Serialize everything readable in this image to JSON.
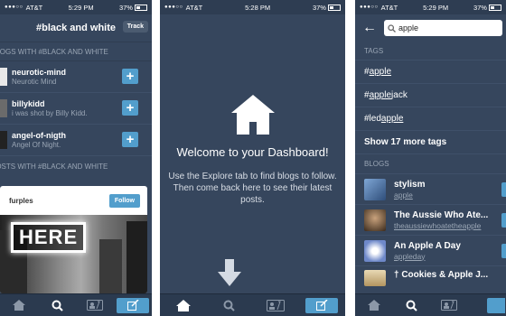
{
  "status": {
    "carrier": "AT&T",
    "time1": "5:29 PM",
    "time2": "5:28 PM",
    "time3": "5:29 PM",
    "battery": "37%"
  },
  "panel1": {
    "title": "#black and white",
    "track_label": "Track",
    "section_blogs": "BLOGS WITH #BLACK AND WHITE",
    "blogs": [
      {
        "name": "neurotic-mind",
        "subtitle": "Neurotic Mind"
      },
      {
        "name": "billykidd",
        "subtitle": "i was shot by Billy Kidd."
      },
      {
        "name": "angel-of-nigth",
        "subtitle": "Angel Of Night."
      }
    ],
    "section_posts": "POSTS WITH #BLACK AND WHITE",
    "post_user": "furples",
    "follow_label": "Follow",
    "sign_text": "HERE"
  },
  "panel2": {
    "welcome_title": "Welcome to your Dashboard!",
    "welcome_body": "Use the Explore tab to find blogs to follow. Then come back here to see their latest posts."
  },
  "panel3": {
    "search_value": "apple",
    "section_tags": "TAGS",
    "tags": [
      {
        "prefix": "#",
        "match": "apple",
        "suffix": ""
      },
      {
        "prefix": "#",
        "match": "apple",
        "suffix": "jack"
      },
      {
        "prefix": "#led ",
        "match": "apple",
        "suffix": ""
      }
    ],
    "more_tags": "Show 17 more tags",
    "section_blogs": "BLOGS",
    "blogs": [
      {
        "name": "stylism",
        "subtitle": "apple"
      },
      {
        "name": "The Aussie Who Ate...",
        "subtitle": "theaussiewhoatetheapple"
      },
      {
        "name": "An Apple A Day",
        "subtitle": "appleday"
      },
      {
        "name": "† Cookies & Apple J...",
        "subtitle": ""
      }
    ]
  },
  "icons": [
    "home-icon",
    "search-icon",
    "activity-icon",
    "compose-icon",
    "down-arrow-icon",
    "back-arrow-icon",
    "plus-icon"
  ],
  "colors": {
    "background": "#36465d",
    "accent": "#529ecc",
    "tabbar": "#2b3a4f"
  }
}
